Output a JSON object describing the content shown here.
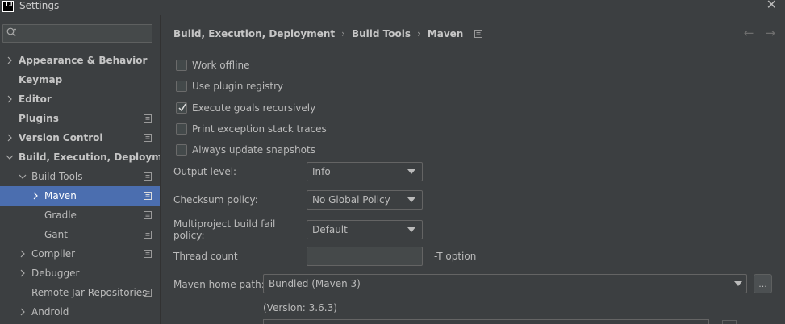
{
  "window": {
    "title": "Settings"
  },
  "search": {
    "placeholder": ""
  },
  "sidebar": {
    "items": [
      {
        "label": "Appearance & Behavior",
        "expandable": true,
        "bold": true
      },
      {
        "label": "Keymap",
        "bold": true
      },
      {
        "label": "Editor",
        "expandable": true,
        "bold": true
      },
      {
        "label": "Plugins",
        "bold": true,
        "project_icon": true
      },
      {
        "label": "Version Control",
        "expandable": true,
        "bold": true,
        "project_icon": true
      },
      {
        "label": "Build, Execution, Deployment",
        "expanded": true,
        "bold": true
      },
      {
        "label": "Build Tools",
        "expanded": true,
        "project_icon": true
      },
      {
        "label": "Maven",
        "expandable": true,
        "selected": true,
        "project_icon": true
      },
      {
        "label": "Gradle",
        "project_icon": true
      },
      {
        "label": "Gant",
        "project_icon": true
      },
      {
        "label": "Compiler",
        "expandable": true,
        "project_icon": true
      },
      {
        "label": "Debugger",
        "expandable": true
      },
      {
        "label": "Remote Jar Repositories",
        "project_icon": true
      },
      {
        "label": "Android",
        "expandable": true
      }
    ]
  },
  "breadcrumb": {
    "part1": "Build, Execution, Deployment",
    "part2": "Build Tools",
    "part3": "Maven",
    "sep": "›"
  },
  "nav": {
    "back": "←",
    "forward": "→"
  },
  "options": [
    {
      "label": "Work offline",
      "checked": false
    },
    {
      "label": "Use plugin registry",
      "checked": false
    },
    {
      "label": "Execute goals recursively",
      "checked": true
    },
    {
      "label": "Print exception stack traces",
      "checked": false
    },
    {
      "label": "Always update snapshots",
      "checked": false
    }
  ],
  "fields": {
    "output_level": {
      "label": "Output level:",
      "value": "Info"
    },
    "checksum_policy": {
      "label": "Checksum policy:",
      "value": "No Global Policy"
    },
    "fail_policy": {
      "label": "Multiproject build fail policy:",
      "value": "Default"
    },
    "thread_count": {
      "label": "Thread count",
      "value": "",
      "suffix": "-T option"
    },
    "maven_home": {
      "label": "Maven home path:",
      "value": "Bundled (Maven 3)",
      "browse": "..."
    },
    "version": "(Version: 3.6.3)"
  },
  "colors": {
    "selection": "#4b6eaf",
    "background": "#3c3f41",
    "text": "#bbbbbb"
  }
}
